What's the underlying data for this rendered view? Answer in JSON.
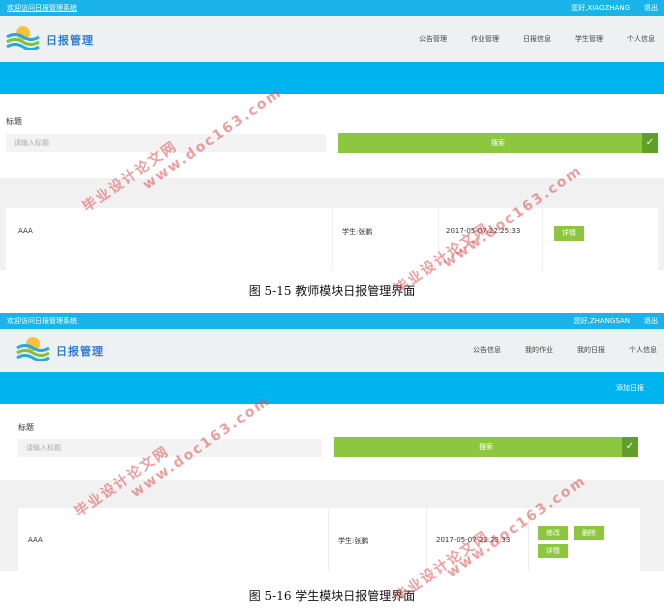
{
  "fig1": {
    "welcome": "欢迎访问日报管理系统",
    "greeting": "您好,XIAOZHANG",
    "logout": "退出",
    "logo_text": "日报管理",
    "nav": [
      "公告管理",
      "作业管理",
      "日报信息",
      "学生管理",
      "个人信息"
    ],
    "search_label": "标题",
    "search_placeholder": "请输入标题",
    "search_button": "搜索",
    "row": {
      "title": "AAA",
      "student": "学生:张鹏",
      "time": "2017-05-07 22:25:33",
      "detail": "详情"
    },
    "caption": "图 5-15 教师模块日报管理界面"
  },
  "fig2": {
    "welcome": "欢迎访问日报管理系统",
    "greeting": "您好,ZHANGSAN",
    "logout": "退出",
    "logo_text": "日报管理",
    "nav": [
      "公告信息",
      "我的作业",
      "我的日报",
      "个人信息"
    ],
    "add_button": "添加日报",
    "search_label": "标题",
    "search_placeholder": "请输入标题",
    "search_button": "搜索",
    "row": {
      "title": "AAA",
      "student": "学生:张鹏",
      "time": "2017-05-07 22:25:33",
      "edit": "修改",
      "delete": "删除",
      "detail": "详情"
    },
    "caption": "图 5-16 学生模块日报管理界面"
  },
  "watermark": {
    "line1": "毕业设计论文网",
    "line2": "www.doc163.com",
    "color": "#e05050"
  },
  "colors": {
    "topbar": "#19b5ea",
    "bluebar": "#00b4ef",
    "green": "#8dc63f",
    "green_dark": "#5f9f2a"
  }
}
